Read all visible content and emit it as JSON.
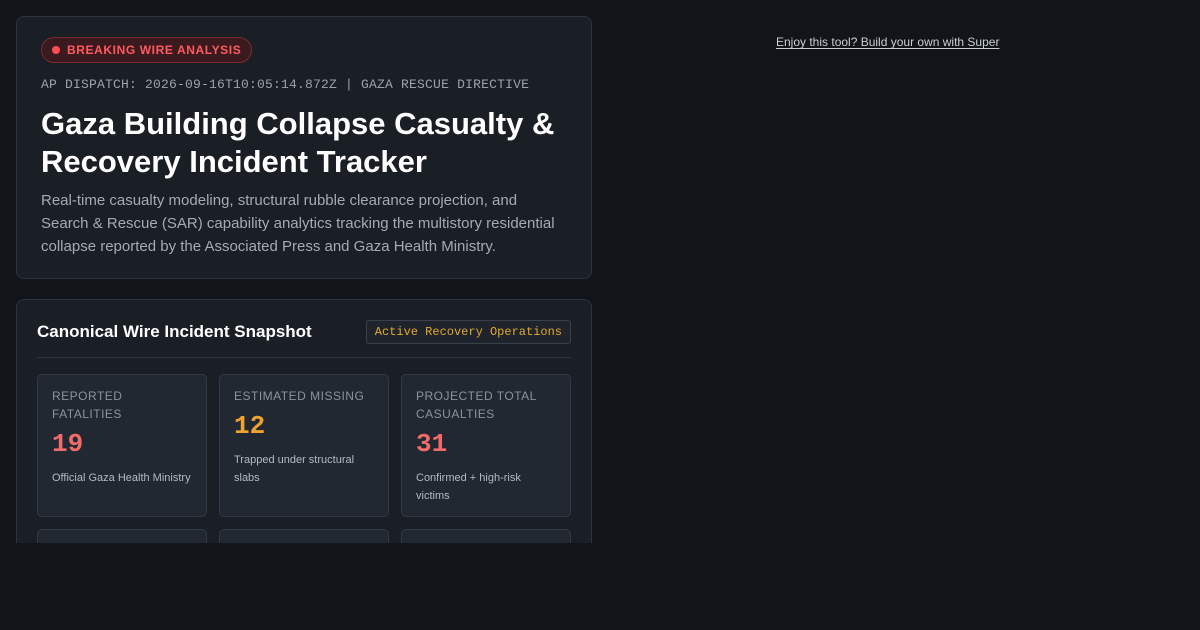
{
  "hero": {
    "badge": "BREAKING WIRE ANALYSIS",
    "dispatch": "AP DISPATCH: 2026-09-16T10:05:14.872Z | GAZA RESCUE DIRECTIVE",
    "title": "Gaza Building Collapse Casualty & Recovery Incident Tracker",
    "description": "Real-time casualty modeling, structural rubble clearance projection, and Search & Rescue (SAR) capability analytics tracking the multistory residential collapse reported by the Associated Press and Gaza Health Ministry."
  },
  "snapshot": {
    "title": "Canonical Wire Incident Snapshot",
    "status": "Active Recovery Operations",
    "metrics": [
      {
        "label": "Reported Fatalities",
        "value": "19",
        "note": "Official Gaza Health Ministry",
        "color": "#f26b6b"
      },
      {
        "label": "Estimated Missing",
        "value": "12",
        "note": "Trapped under structural slabs",
        "color": "#f0a22e"
      },
      {
        "label": "Projected Total Casualties",
        "value": "31",
        "note": "Confirmed + high-risk victims",
        "color": "#f26b6b"
      }
    ]
  },
  "promo": {
    "link": "Enjoy this tool? Build your own with Super"
  },
  "colors": {
    "background": "#111418",
    "card": "#1a1e25",
    "badge_red": "#ff5a60",
    "amber": "#e3a82b"
  }
}
